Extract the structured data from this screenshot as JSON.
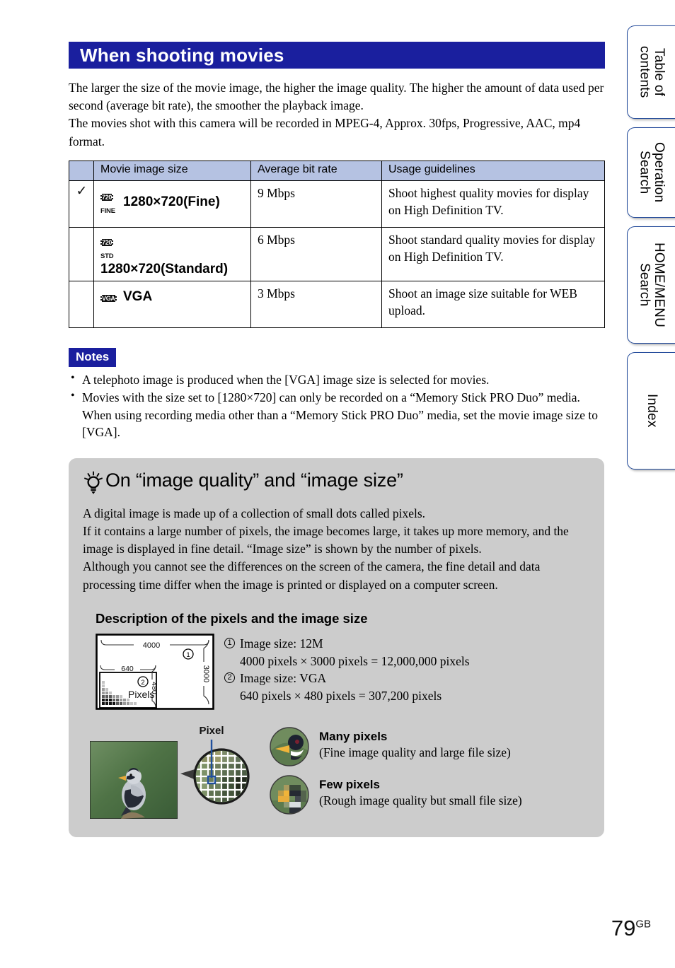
{
  "side_tabs": [
    {
      "label": "Table of\ncontents"
    },
    {
      "label": "Operation\nSearch"
    },
    {
      "label": "HOME/MENU\nSearch"
    },
    {
      "label": "Index"
    }
  ],
  "header": {
    "title": "When shooting movies",
    "title_bg": "#1a1f9e"
  },
  "intro": {
    "line1": "The larger the size of the movie image, the higher the image quality. The higher the amount of data used per second (average bit rate), the smoother the playback image.",
    "line2": "The movies shot with this camera will be recorded in MPEG-4, Approx. 30fps, Progressive, AAC, mp4 format."
  },
  "table": {
    "header_bg": "#b5c2e2",
    "columns": [
      "",
      "Movie image size",
      "Average bit rate",
      "Usage guidelines"
    ],
    "rows": [
      {
        "checked": "✓",
        "badge_top": "720",
        "badge_sub": "FINE",
        "size": "1280×720(Fine)",
        "rate": "9 Mbps",
        "usage": "Shoot highest quality movies for display on High Definition TV."
      },
      {
        "checked": "",
        "badge_top": "720",
        "badge_sub": "STD",
        "size": "1280×720(Standard)",
        "rate": "6 Mbps",
        "usage": "Shoot standard quality movies for display on High Definition TV."
      },
      {
        "checked": "",
        "badge_top": "VGA",
        "badge_sub": "",
        "size": "VGA",
        "rate": "3 Mbps",
        "usage": "Shoot an image size suitable for WEB upload."
      }
    ]
  },
  "notes": {
    "label": "Notes",
    "items": [
      "A telephoto image is produced when the [VGA] image size is selected for movies.",
      "Movies with the size set to [1280×720] can only be recorded on a “Memory Stick PRO Duo” media. When using recording media other than a “Memory Stick PRO Duo” media, set the movie image size to [VGA]."
    ]
  },
  "tip": {
    "title": "On “image quality” and “image size”",
    "bg": "#cccccc",
    "body": [
      "A digital image is made up of a collection of small dots called pixels.",
      "If it contains a large number of pixels, the image becomes large, it takes up more memory, and the image is displayed in fine detail. “Image size” is shown by the number of pixels.",
      "Although you cannot see the differences on the screen of the camera, the fine detail and data processing time differ when the image is printed or displayed on a computer screen."
    ],
    "subhead": "Description of the pixels and the image size",
    "diagram": {
      "width_label": "4000",
      "height_label": "3000",
      "inner_width_label": "640",
      "inner_height_label": "480",
      "pixels_label": "Pixels",
      "marker_1": "1",
      "marker_2": "2"
    },
    "sizes": [
      {
        "num": "1",
        "title": "Image size: 12M",
        "detail": "4000 pixels × 3000 pixels = 12,000,000 pixels"
      },
      {
        "num": "2",
        "title": "Image size: VGA",
        "detail": "640 pixels × 480 pixels = 307,200 pixels"
      }
    ],
    "pixel_label": "Pixel",
    "comparison": [
      {
        "title": "Many pixels",
        "detail": "(Fine image quality and large file size)"
      },
      {
        "title": "Few pixels",
        "detail": "(Rough image quality but small file size)"
      }
    ]
  },
  "footer": {
    "page_number": "79",
    "page_suffix": "GB"
  }
}
